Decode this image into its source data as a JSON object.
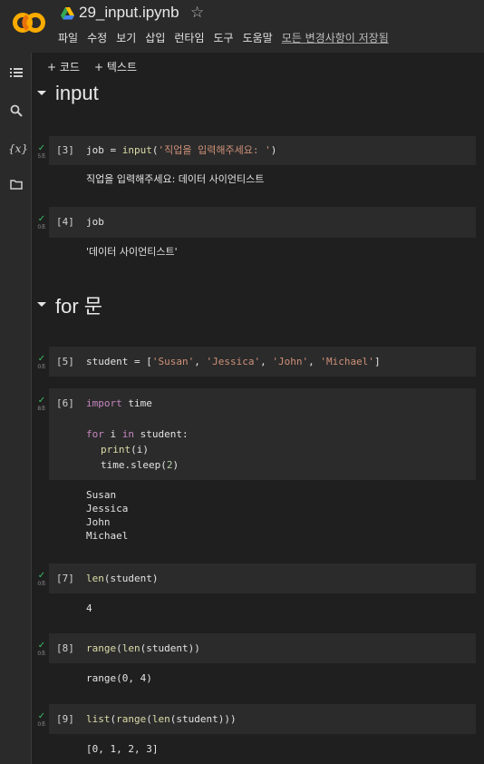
{
  "app": {
    "title": "29_input.ipynb",
    "menu": [
      "파일",
      "수정",
      "보기",
      "삽입",
      "런타임",
      "도구",
      "도움말"
    ],
    "save_status": "모든 변경사항이 저장됨"
  },
  "toolbar": {
    "add_code": "+ 코드",
    "add_text": "+ 텍스트"
  },
  "sidebar": {
    "variables_label": "{x}"
  },
  "sections": [
    {
      "title": "input"
    },
    {
      "title": "for 문"
    }
  ],
  "cells": [
    {
      "exec": "[3]",
      "time": "5초",
      "output": "직업을 입력해주세요: 데이터 사이언티스트"
    },
    {
      "exec": "[4]",
      "time": "0초",
      "output": "'데이터 사이언티스트'"
    },
    {
      "exec": "[5]",
      "time": "0초"
    },
    {
      "exec": "[6]",
      "time": "8초",
      "output_lines": [
        "Susan",
        "Jessica",
        "John",
        "Michael"
      ]
    },
    {
      "exec": "[7]",
      "time": "0초",
      "output": "4"
    },
    {
      "exec": "[8]",
      "time": "0초",
      "output": "range(0, 4)"
    },
    {
      "exec": "[9]",
      "time": "0초",
      "output": "[0, 1, 2, 3]"
    }
  ],
  "code": {
    "c3": {
      "var": "job",
      "eq": " = ",
      "fn": "input",
      "open": "(",
      "str": "'직업을 입력해주세요: '",
      "close": ")"
    },
    "c4": "job",
    "c5": {
      "var": "student",
      "eq": " = [",
      "s1": "'Susan'",
      "sep1": ", ",
      "s2": "'Jessica'",
      "sep2": ", ",
      "s3": "'John'",
      "sep3": ", ",
      "s4": "'Michael'",
      "close": "]"
    },
    "c6": {
      "l1_kw": "import",
      "l1_rest": " time",
      "l2_kw1": "for",
      "l2_mid": " i ",
      "l2_kw2": "in",
      "l2_rest": " student:",
      "l3_fn": "print",
      "l3_rest": "(i)",
      "l4_pre": "time.sleep(",
      "l4_num": "2",
      "l4_close": ")"
    },
    "c7": {
      "fn": "len",
      "rest": "(student)"
    },
    "c8": {
      "fn1": "range",
      "p1": "(",
      "fn2": "len",
      "rest": "(student))"
    },
    "c9": {
      "fn1": "list",
      "p1": "(",
      "fn2": "range",
      "p2": "(",
      "fn3": "len",
      "rest": "(student)))"
    }
  },
  "colors": {
    "check": "#3bbf65",
    "keyword": "#c586c0",
    "function": "#dcdcaa",
    "string": "#ce9178",
    "number": "#b5cea8"
  }
}
